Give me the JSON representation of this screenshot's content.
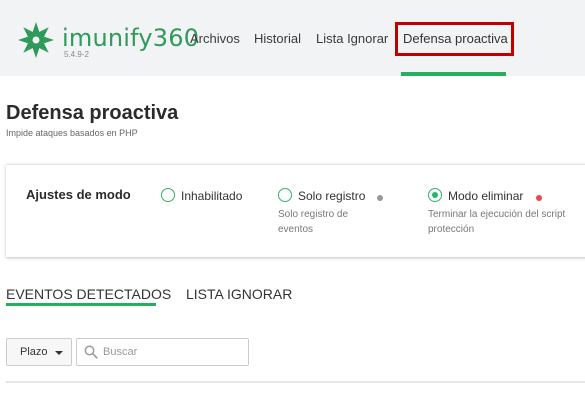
{
  "app": {
    "logo_text": "imunify360",
    "version": "5.4.9-2",
    "brand_color": "#2f9a5a",
    "accent_color": "#27ae60",
    "highlight_color": "#c00000"
  },
  "nav": {
    "items": [
      {
        "label": "Archivos"
      },
      {
        "label": "Historial"
      },
      {
        "label": "Lista Ignorar"
      },
      {
        "label": "Defensa proactiva",
        "active": true
      }
    ]
  },
  "page": {
    "title": "Defensa proactiva",
    "subtitle": "Impide ataques basados en PHP"
  },
  "mode_settings": {
    "label": "Ajustes de modo",
    "options": [
      {
        "label": "Inhabilitado",
        "checked": false,
        "description": []
      },
      {
        "label": "Solo registro",
        "checked": false,
        "status_color": "#999999",
        "description": [
          "Solo registro de",
          "eventos"
        ]
      },
      {
        "label": "Modo eliminar",
        "checked": true,
        "status_color": "#e8474c",
        "description": [
          "Terminar la ejecución del script",
          "protección"
        ]
      }
    ]
  },
  "tabs": [
    {
      "label": "EVENTOS DETECTADOS",
      "active": true
    },
    {
      "label": "LISTA IGNORAR",
      "active": false
    }
  ],
  "toolbar": {
    "period_label": "Plazo",
    "search_placeholder": "Buscar",
    "search_value": ""
  }
}
